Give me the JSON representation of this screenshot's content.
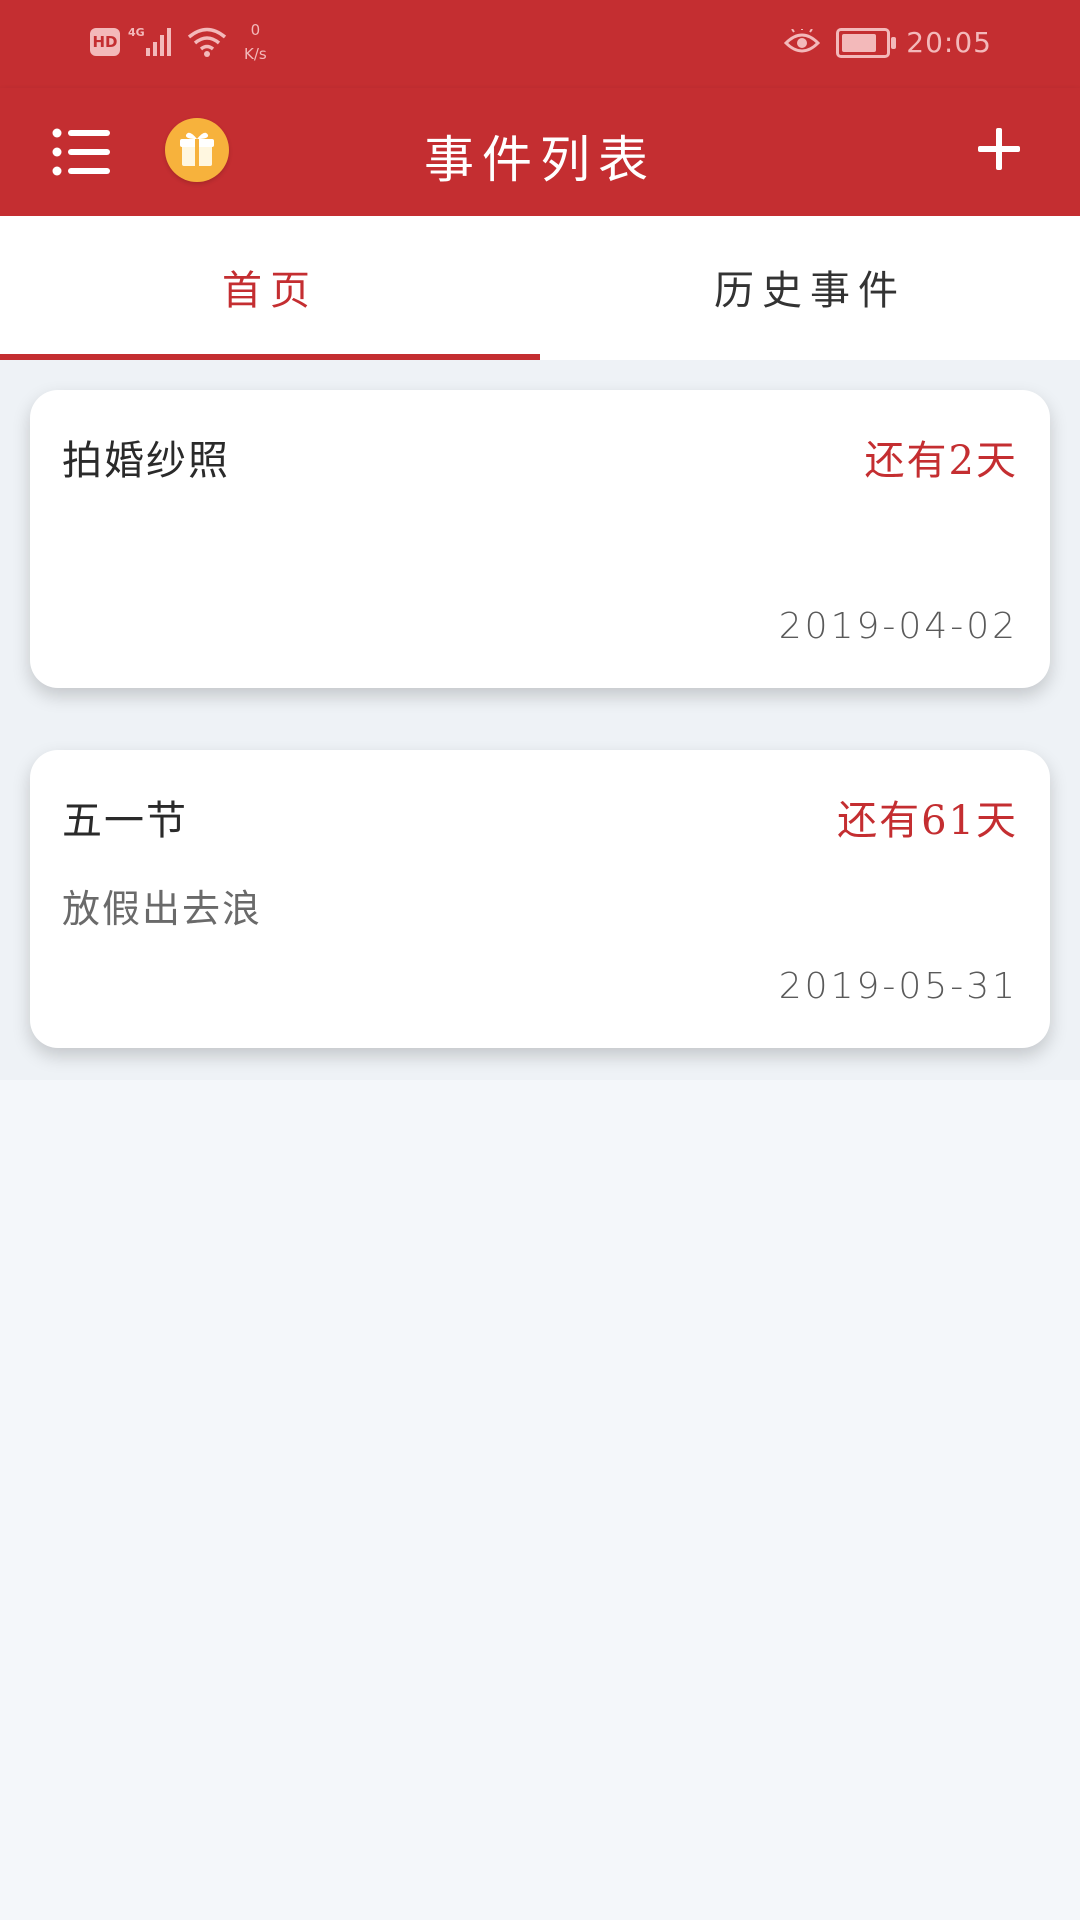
{
  "status_bar": {
    "hd": "HD",
    "signal": "4G",
    "speed_value": "0",
    "speed_unit": "K/s",
    "time": "20:05"
  },
  "app_bar": {
    "title": "事件列表",
    "menu_icon": "menu-icon",
    "gift_icon": "gift-icon",
    "add_icon": "plus-icon"
  },
  "tabs": [
    {
      "label": "首页",
      "active": true
    },
    {
      "label": "历史事件",
      "active": false
    }
  ],
  "events": [
    {
      "title": "拍婚纱照",
      "remaining": "还有2天",
      "note": "",
      "date": "2019-04-02"
    },
    {
      "title": "五一节",
      "remaining": "还有61天",
      "note": "放假出去浪",
      "date": "2019-05-31"
    }
  ],
  "colors": {
    "primary": "#c42e31",
    "gift": "#f7b23c",
    "background": "#f4f7fa"
  }
}
